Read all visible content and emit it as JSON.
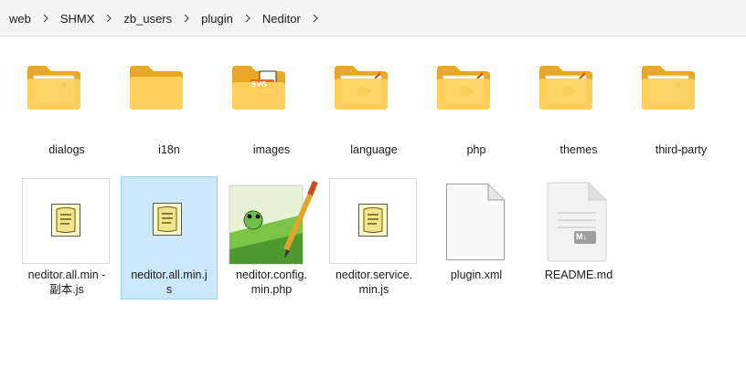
{
  "breadcrumb": [
    "web",
    "SHMX",
    "zb_users",
    "plugin",
    "Neditor"
  ],
  "folders": [
    {
      "name": "dialogs",
      "overlay": "doc"
    },
    {
      "name": "i18n",
      "overlay": "none"
    },
    {
      "name": "images",
      "overlay": "svg",
      "badge": "SVG"
    },
    {
      "name": "language",
      "overlay": "notepad"
    },
    {
      "name": "php",
      "overlay": "notepad"
    },
    {
      "name": "themes",
      "overlay": "notepad"
    },
    {
      "name": "third-party",
      "overlay": "doc"
    }
  ],
  "files": [
    {
      "line1": "neditor.all.min -",
      "line2": "副本.js",
      "icon": "script",
      "selected": false
    },
    {
      "line1": "neditor.all.min.j",
      "line2": "s",
      "icon": "script",
      "selected": true
    },
    {
      "line1": "neditor.config.",
      "line2": "min.php",
      "icon": "notepadpp",
      "selected": false
    },
    {
      "line1": "neditor.service.",
      "line2": "min.js",
      "icon": "script",
      "selected": false
    },
    {
      "line1": "plugin.xml",
      "line2": "",
      "icon": "blank-file",
      "selected": false
    },
    {
      "line1": "README.md",
      "line2": "",
      "icon": "markdown-file",
      "badge": "M↓",
      "selected": false
    }
  ],
  "colors": {
    "folder_back": "#e8a825",
    "folder_front": "#ffd15b",
    "selection_bg": "#cce8ff",
    "selection_border": "#99d1ff"
  }
}
